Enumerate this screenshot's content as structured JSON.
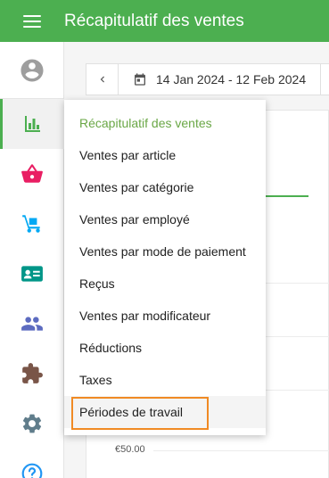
{
  "appbar": {
    "title": "Récapitulatif des ventes",
    "color": "#4caf50"
  },
  "sidebar": {
    "items": [
      {
        "icon": "account-circle-icon",
        "color": "#9e9e9e"
      },
      {
        "icon": "bar-chart-icon",
        "color": "#4caf50",
        "active": true
      },
      {
        "icon": "basket-icon",
        "color": "#e91e63"
      },
      {
        "icon": "hand-truck-icon",
        "color": "#03a9f4"
      },
      {
        "icon": "id-card-icon",
        "color": "#009688"
      },
      {
        "icon": "people-icon",
        "color": "#5c6bc0"
      },
      {
        "icon": "puzzle-icon",
        "color": "#795548"
      },
      {
        "icon": "gear-icon",
        "color": "#607d8b"
      },
      {
        "icon": "help-icon",
        "color": "#2196f3"
      }
    ]
  },
  "toolbar": {
    "date_range": "14 Jan 2024 - 12 Feb 2024"
  },
  "chart": {
    "axis_label": "€50.00"
  },
  "dropdown": {
    "items": [
      {
        "label": "Récapitulatif des ventes",
        "selected": true
      },
      {
        "label": "Ventes par article"
      },
      {
        "label": "Ventes par catégorie"
      },
      {
        "label": "Ventes par employé"
      },
      {
        "label": "Ventes par mode de paiement"
      },
      {
        "label": "Reçus"
      },
      {
        "label": "Ventes par modificateur"
      },
      {
        "label": "Réductions"
      },
      {
        "label": "Taxes"
      },
      {
        "label": "Périodes de travail",
        "highlighted": true
      }
    ]
  }
}
